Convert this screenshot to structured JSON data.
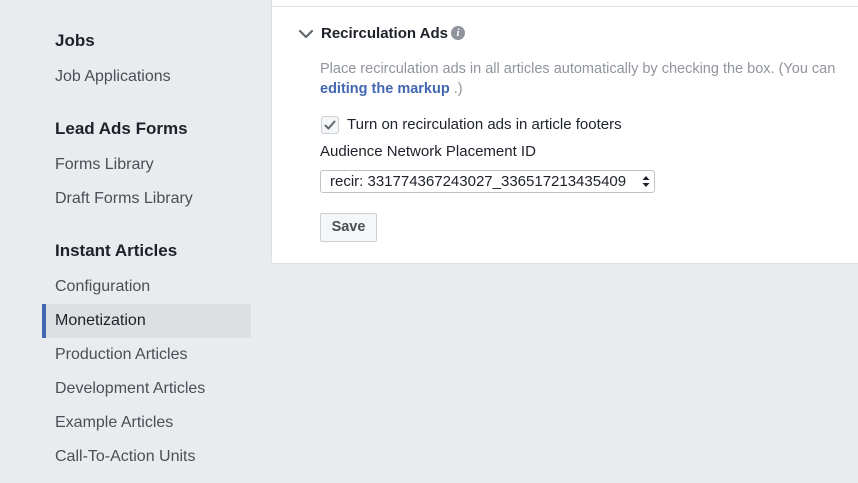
{
  "sidebar": {
    "sections": [
      {
        "title": "Jobs",
        "items": [
          "Job Applications"
        ]
      },
      {
        "title": "Lead Ads Forms",
        "items": [
          "Forms Library",
          "Draft Forms Library"
        ]
      },
      {
        "title": "Instant Articles",
        "items": [
          "Configuration",
          "Monetization",
          "Production Articles",
          "Development Articles",
          "Example Articles",
          "Call-To-Action Units"
        ]
      }
    ],
    "active_item": "Monetization"
  },
  "panel": {
    "title": "Recirculation Ads",
    "info_icon": "info-icon",
    "description_line1": "Place recirculation ads in all articles automatically by checking the box. (You can",
    "description_link": "editing the markup",
    "description_tail": " .)",
    "checkbox": {
      "label": "Turn on recirculation ads in article footers",
      "checked": true
    },
    "placement_label": "Audience Network Placement ID",
    "placement_value": "recir: 331774367243027_336517213435409",
    "save_label": "Save"
  },
  "colors": {
    "background": "#e9ebee",
    "accent": "#4267b2",
    "active_bg": "#dddfe2",
    "panel_bg": "#ffffff"
  }
}
